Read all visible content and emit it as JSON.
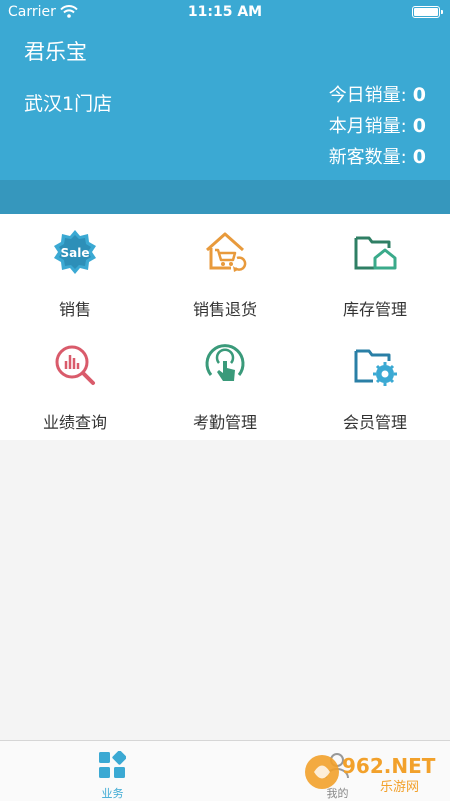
{
  "status_bar": {
    "carrier": "Carrier",
    "time": "11:15 AM"
  },
  "header": {
    "brand": "君乐宝",
    "store": "武汉1门店",
    "stats": [
      {
        "label": "今日销量:",
        "value": "0"
      },
      {
        "label": "本月销量:",
        "value": "0"
      },
      {
        "label": "新客数量:",
        "value": "0"
      }
    ]
  },
  "menu": [
    {
      "label": "销售",
      "icon": "sale-badge-icon"
    },
    {
      "label": "销售退货",
      "icon": "cart-return-icon"
    },
    {
      "label": "库存管理",
      "icon": "folder-home-icon"
    },
    {
      "label": "业绩查询",
      "icon": "chart-search-icon"
    },
    {
      "label": "考勤管理",
      "icon": "touch-hand-icon"
    },
    {
      "label": "会员管理",
      "icon": "folder-gear-icon"
    }
  ],
  "tabs": [
    {
      "label": "业务",
      "icon": "grid-icon"
    },
    {
      "label": "我的",
      "icon": "user-icon"
    }
  ],
  "watermark": {
    "text": "962.NET",
    "subtext": "乐游网"
  },
  "colors": {
    "primary": "#3ba9d3",
    "band": "#3697bd",
    "orange": "#e89a3c",
    "green": "#3a9a7a",
    "red": "#d95b6b"
  }
}
